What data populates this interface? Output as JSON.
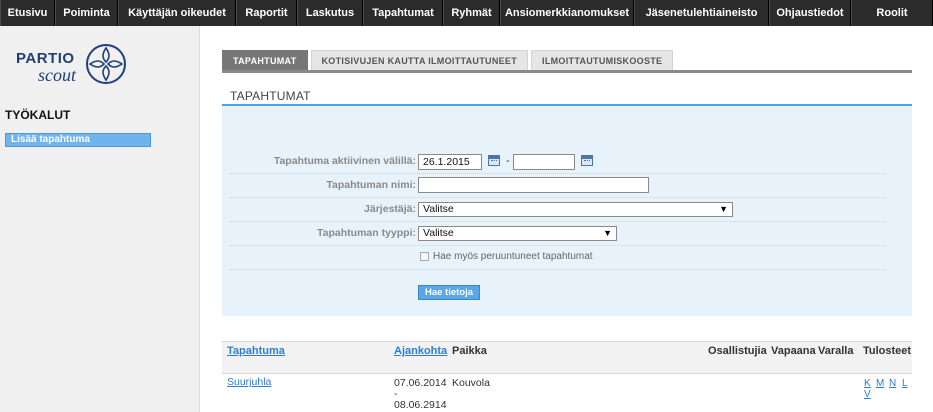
{
  "nav": {
    "items": [
      {
        "label": "Etusivu",
        "w": 55
      },
      {
        "label": "Poiminta",
        "w": 63
      },
      {
        "label": "Käyttäjän oikeudet",
        "w": 118
      },
      {
        "label": "Raportit",
        "w": 61
      },
      {
        "label": "Laskutus",
        "w": 66
      },
      {
        "label": "Tapahtumat",
        "w": 80
      },
      {
        "label": "Ryhmät",
        "w": 57
      },
      {
        "label": "Ansiomerkkianomukset",
        "w": 134
      },
      {
        "label": "Jäsenetulehtiaineisto",
        "w": 135
      },
      {
        "label": "Ohjaustiedot",
        "w": 82
      },
      {
        "label": "Roolit",
        "w": 82
      }
    ]
  },
  "logo": {
    "word1": "PARTIO",
    "word2": "scout"
  },
  "sidebar": {
    "heading": "TYÖKALUT",
    "link": "Lisää tapahtuma"
  },
  "tabs": [
    {
      "label": "TAPAHTUMAT",
      "active": true
    },
    {
      "label": "KOTISIVUJEN KAUTTA ILMOITTAUTUNEET",
      "active": false
    },
    {
      "label": "ILMOITTAUTUMISKOOSTE",
      "active": false
    }
  ],
  "section_title": "TAPAHTUMAT",
  "form": {
    "active_between_label": "Tapahtuma aktiivinen välillä:",
    "date_from": "26.1.2015",
    "date_to": "",
    "date_separator": "-",
    "name_label": "Tapahtuman nimi:",
    "name_value": "",
    "organizer_label": "Järjestäjä:",
    "organizer_value": "Valitse",
    "type_label": "Tapahtuman tyyppi:",
    "type_value": "Valitse",
    "cancelled_label": "Hae myös peruuntuneet tapahtumat",
    "submit_label": "Hae tietoja"
  },
  "table": {
    "headers": {
      "event": "Tapahtuma",
      "period": "Ajankohta",
      "place": "Paikka",
      "participants": "Osallistujia",
      "free": "Vapaana",
      "reserve": "Varalla",
      "reports": "Tulosteet"
    },
    "rows": [
      {
        "event": "Suurjuhla",
        "start": "07.06.2014",
        "dash": "-",
        "end": "08.06.2914",
        "place": "Kouvola",
        "report_links": [
          "K",
          "M",
          "N",
          "L",
          "V"
        ]
      }
    ]
  }
}
